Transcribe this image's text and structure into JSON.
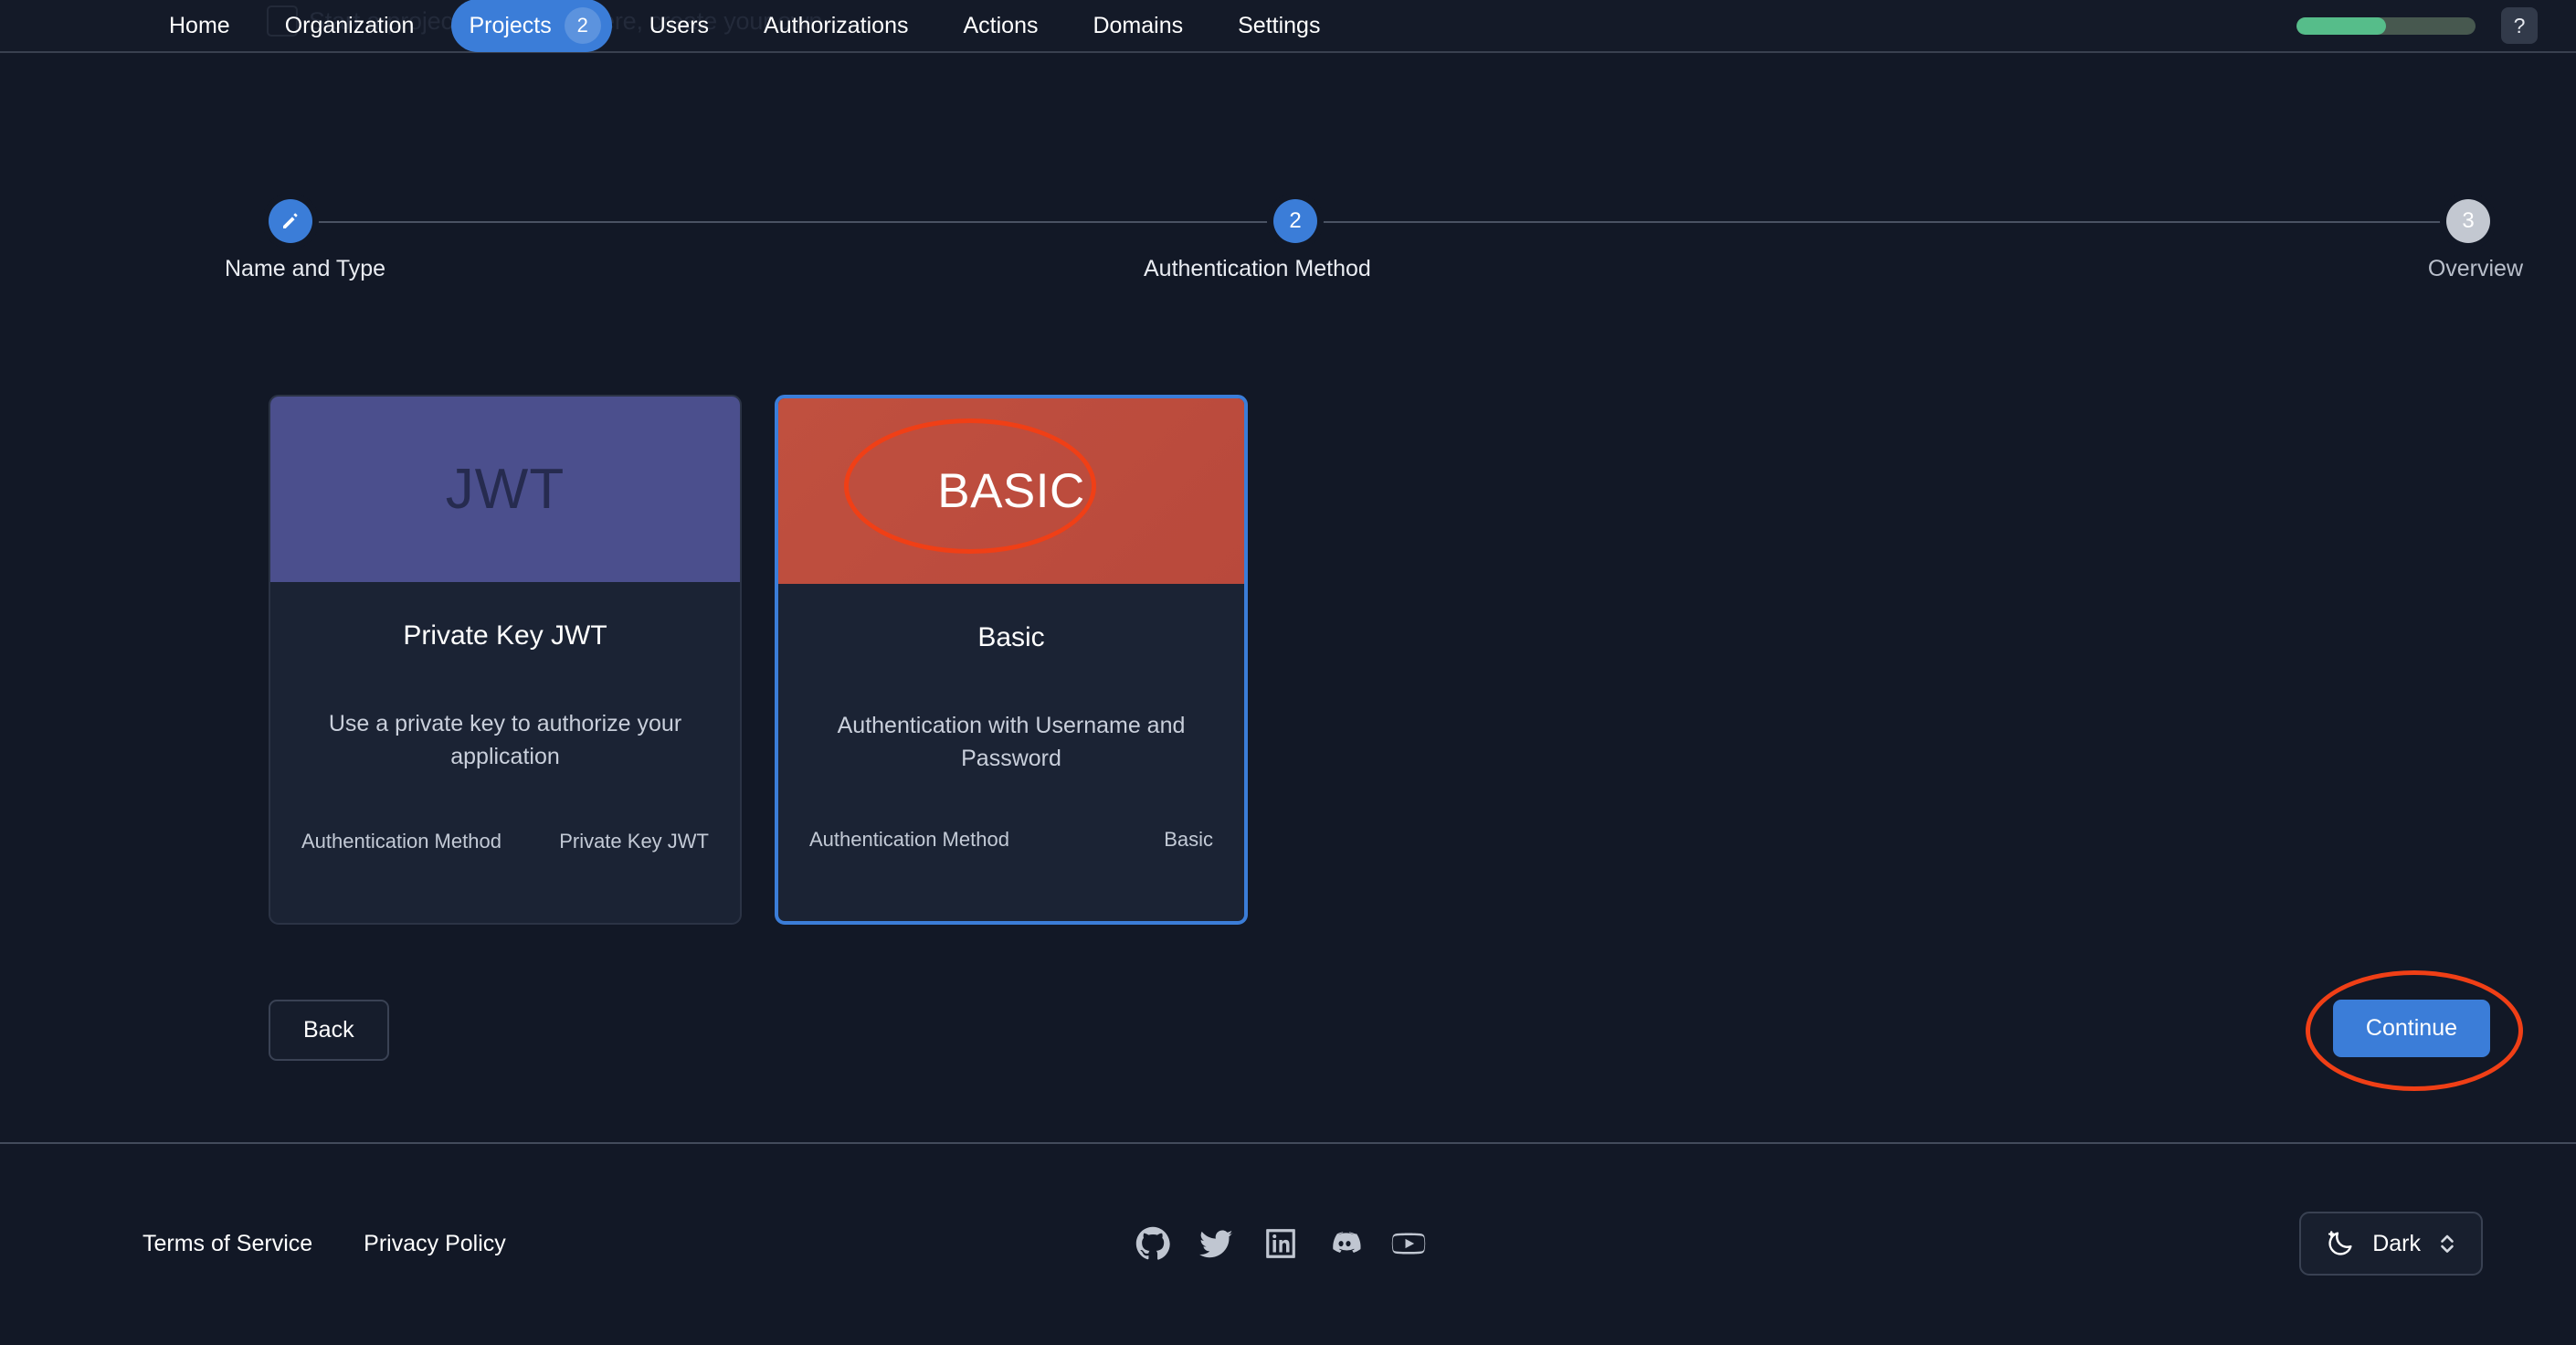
{
  "header": {
    "ghost_text": "Start a project: Skip them here, create your own.",
    "nav_items": [
      {
        "label": "Home",
        "active": false,
        "badge": null
      },
      {
        "label": "Organization",
        "active": false,
        "badge": null
      },
      {
        "label": "Projects",
        "active": true,
        "badge": "2"
      },
      {
        "label": "Users",
        "active": false,
        "badge": null
      },
      {
        "label": "Authorizations",
        "active": false,
        "badge": null
      },
      {
        "label": "Actions",
        "active": false,
        "badge": null
      },
      {
        "label": "Domains",
        "active": false,
        "badge": null
      },
      {
        "label": "Settings",
        "active": false,
        "badge": null
      }
    ],
    "progress": {
      "percent": 50,
      "fill_color": "#56bd8a",
      "track_color": "#47584f"
    },
    "help_label": "?",
    "accent_color": "#3b7dd8"
  },
  "stepper": {
    "steps": [
      {
        "number": "1",
        "label": "Name and Type",
        "state": "completed",
        "icon": "pencil-icon"
      },
      {
        "number": "2",
        "label": "Authentication Method",
        "state": "current",
        "icon": null
      },
      {
        "number": "3",
        "label": "Overview",
        "state": "upcoming",
        "icon": null
      }
    ]
  },
  "cards": [
    {
      "banner_text": "JWT",
      "title": "Private Key JWT",
      "description": "Use a private key to authorize your application",
      "meta_label": "Authentication Method",
      "meta_value": "Private Key JWT",
      "selected": false,
      "banner_color": "#4b4f8d"
    },
    {
      "banner_text": "BASIC",
      "title": "Basic",
      "description": "Authentication with Username and Password",
      "meta_label": "Authentication Method",
      "meta_value": "Basic",
      "selected": true,
      "banner_color": "#bd4b3d"
    }
  ],
  "actions": {
    "back_label": "Back",
    "continue_label": "Continue"
  },
  "annotations": {
    "color": "#f03f16",
    "targets": [
      "basic-card-banner",
      "continue-button"
    ]
  },
  "footer": {
    "links": [
      {
        "label": "Terms of Service"
      },
      {
        "label": "Privacy Policy"
      }
    ],
    "social": [
      {
        "name": "github-icon"
      },
      {
        "name": "twitter-icon"
      },
      {
        "name": "linkedin-icon"
      },
      {
        "name": "discord-icon"
      },
      {
        "name": "youtube-icon"
      }
    ],
    "theme": {
      "label": "Dark",
      "icon": "moon-icon",
      "chevron": "chevron-updown-icon"
    }
  }
}
